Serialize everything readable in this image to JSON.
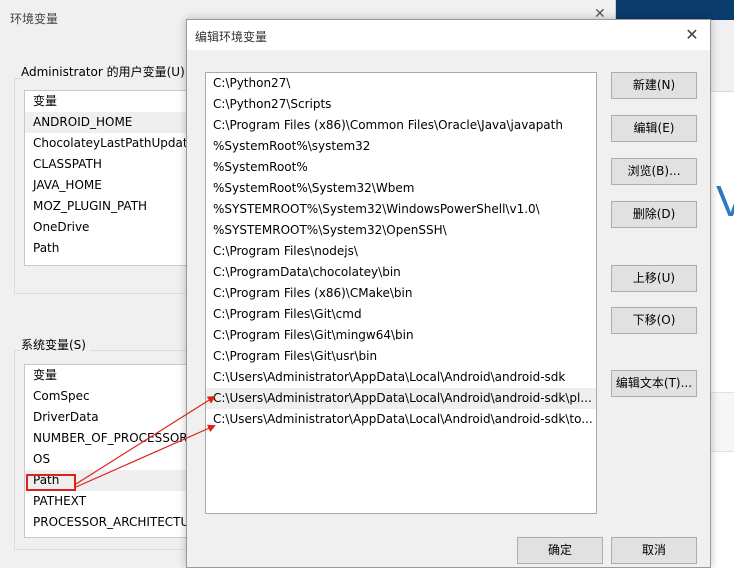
{
  "back_window": {
    "title": "环境变量",
    "close": "✕",
    "user_vars": {
      "group_label": "Administrator 的用户变量(U)",
      "header": "变量",
      "items": [
        "ANDROID_HOME",
        "ChocolateyLastPathUpdate",
        "CLASSPATH",
        "JAVA_HOME",
        "MOZ_PLUGIN_PATH",
        "OneDrive",
        "Path"
      ]
    },
    "system_vars": {
      "group_label": "系统变量(S)",
      "header": "变量",
      "items": [
        "ComSpec",
        "DriverData",
        "NUMBER_OF_PROCESSORS",
        "OS",
        "Path",
        "PATHEXT",
        "PROCESSOR_ARCHITECTURE"
      ]
    }
  },
  "dialog": {
    "title": "编辑环境变量",
    "close": "✕",
    "paths": [
      "C:\\Python27\\",
      "C:\\Python27\\Scripts",
      "C:\\Program Files (x86)\\Common Files\\Oracle\\Java\\javapath",
      "%SystemRoot%\\system32",
      "%SystemRoot%",
      "%SystemRoot%\\System32\\Wbem",
      "%SYSTEMROOT%\\System32\\WindowsPowerShell\\v1.0\\",
      "%SYSTEMROOT%\\System32\\OpenSSH\\",
      "C:\\Program Files\\nodejs\\",
      "C:\\ProgramData\\chocolatey\\bin",
      "C:\\Program Files (x86)\\CMake\\bin",
      "C:\\Program Files\\Git\\cmd",
      "C:\\Program Files\\Git\\mingw64\\bin",
      "C:\\Program Files\\Git\\usr\\bin",
      "C:\\Users\\Administrator\\AppData\\Local\\Android\\android-sdk",
      "C:\\Users\\Administrator\\AppData\\Local\\Android\\android-sdk\\pl...",
      "C:\\Users\\Administrator\\AppData\\Local\\Android\\android-sdk\\to..."
    ],
    "buttons": {
      "new": "新建(N)",
      "edit": "编辑(E)",
      "browse": "浏览(B)...",
      "delete": "删除(D)",
      "move_up": "上移(U)",
      "move_down": "下移(O)",
      "edit_text": "编辑文本(T)...",
      "ok": "确定",
      "cancel": "取消"
    }
  },
  "background": {
    "glyph": "V"
  },
  "colors": {
    "annotation_red": "#e0201a",
    "accent_blue": "#2f78c4"
  }
}
